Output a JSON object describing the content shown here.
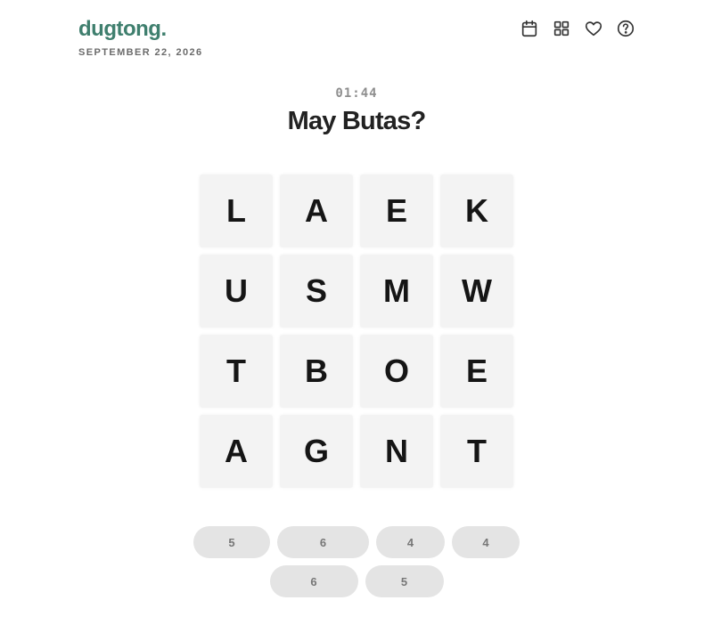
{
  "header": {
    "logo": "dugtong.",
    "date": "SEPTEMBER 22, 2026",
    "icons": [
      "calendar-icon",
      "grid-icon",
      "heart-icon",
      "help-icon"
    ]
  },
  "game": {
    "timer": "01:44",
    "title": "May Butas?",
    "tiles": [
      "L",
      "A",
      "E",
      "K",
      "U",
      "S",
      "M",
      "W",
      "T",
      "B",
      "O",
      "E",
      "A",
      "G",
      "N",
      "T"
    ],
    "word_lengths_row1": [
      "5",
      "6",
      "4",
      "4"
    ],
    "word_lengths_row2": [
      "6",
      "5"
    ]
  },
  "colors": {
    "brand": "#3f7f6e",
    "tile_bg": "#f3f3f3",
    "chip_bg": "#e4e4e4"
  }
}
